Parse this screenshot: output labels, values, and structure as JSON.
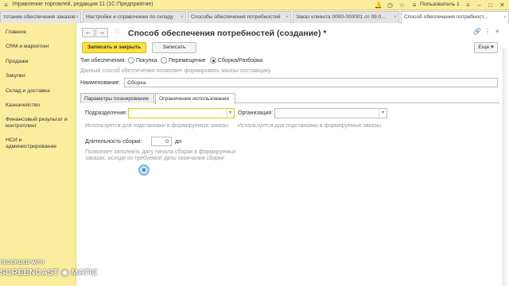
{
  "titlebar": {
    "title": "Управление торговлей, редакция 11  (1С:Предприятие)",
    "user": "Пользователь 1",
    "icons": [
      "menu-icon",
      "bell-icon",
      "history-icon",
      "star-icon",
      "minimize-icon",
      "maximize-icon",
      "close-icon"
    ]
  },
  "tabs": [
    {
      "label": "тотание обеспечения заказов"
    },
    {
      "label": "Настройки и справочники по складу"
    },
    {
      "label": "Способы обеспечения потребностей"
    },
    {
      "label": "Заказ клиента 0000-000001 от 09.0..."
    },
    {
      "label": "Способ обеспечения потребност..."
    }
  ],
  "sidebar": {
    "items": [
      {
        "label": "Главное"
      },
      {
        "label": "CRM и маркетинг"
      },
      {
        "label": "Продажи"
      },
      {
        "label": "Закупки"
      },
      {
        "label": "Склад и доставка"
      },
      {
        "label": "Казначейство"
      },
      {
        "label": "Финансовый результат и контроллинг"
      },
      {
        "label": "НСИ и администрирование"
      }
    ]
  },
  "form": {
    "back": "←",
    "forward": "→",
    "title": "Способ обеспечения потребностей (создание) *",
    "save_close": "Записать и закрыть",
    "save": "Записать",
    "more": "Еще",
    "type_label": "Тип обеспечения:",
    "type_options": [
      "Покупка",
      "Перемещение",
      "Сборка/Разборка"
    ],
    "type_selected": "Сборка/Разборка",
    "type_hint": "Данный способ обеспечения позволяет формировать заказы поставщику.",
    "name_label": "Наименование:",
    "name_value": "Сборка",
    "form_tabs": [
      "Параметры планирования",
      "Ограничение использования"
    ],
    "dept_label": "Подразделение:",
    "dept_value": "",
    "org_label": "Организация:",
    "org_value": "",
    "dept_hint": "Используется для подстановки в формируемые заказы",
    "org_hint": "Используется для подстановки в формируемые заказы",
    "duration_label": "Длительность сборки:",
    "duration_value": "0",
    "duration_unit": "дн",
    "duration_hint": "Позволяет заполнить дату начала сборки в формируемых заказах, исходя из требуемой даты окончания сборки"
  },
  "watermark": {
    "top": "RECORDED WITH",
    "bottom": "SCREENCAST ◉ MATIC"
  },
  "colors": {
    "accent": "#fbe13f",
    "panel": "#fbed9e"
  }
}
